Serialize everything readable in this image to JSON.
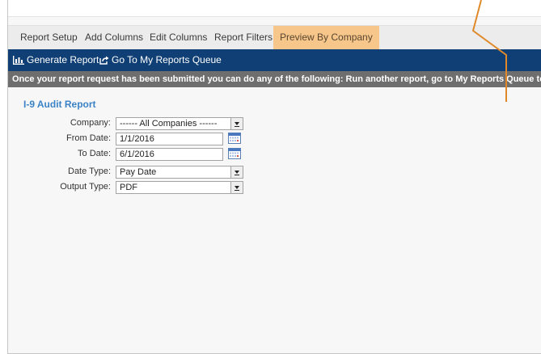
{
  "tabs": [
    {
      "label": "Report Setup"
    },
    {
      "label": "Add Columns"
    },
    {
      "label": "Edit Columns"
    },
    {
      "label": "Report Filters"
    },
    {
      "label": "Preview By Company",
      "active": true
    }
  ],
  "toolbar": {
    "generate_label": "Generate Report",
    "queue_label": "Go To My Reports Queue"
  },
  "notice": "Once your report request has been submitted you can do any of the following: Run another report, go to My Reports Queue to retrieve reports, or exit t",
  "report": {
    "title": "I-9 Audit Report",
    "company_label": "Company:",
    "company_value": "------ All Companies ------",
    "from_label": "From Date:",
    "from_value": "1/1/2016",
    "to_label": "To Date:",
    "to_value": "6/1/2016",
    "datetype_label": "Date Type:",
    "datetype_value": "Pay Date",
    "output_label": "Output Type:",
    "output_value": "PDF"
  },
  "colors": {
    "toolbar_bg": "#0f3f75",
    "active_tab": "#f6c68a",
    "notice_bg": "#6e6e6e",
    "title": "#3b83c6",
    "annotation_arrow": "#e0892a"
  },
  "icons": {
    "generate": "bar-chart-icon",
    "queue": "share-arrow-icon",
    "calendar": "calendar-icon"
  }
}
